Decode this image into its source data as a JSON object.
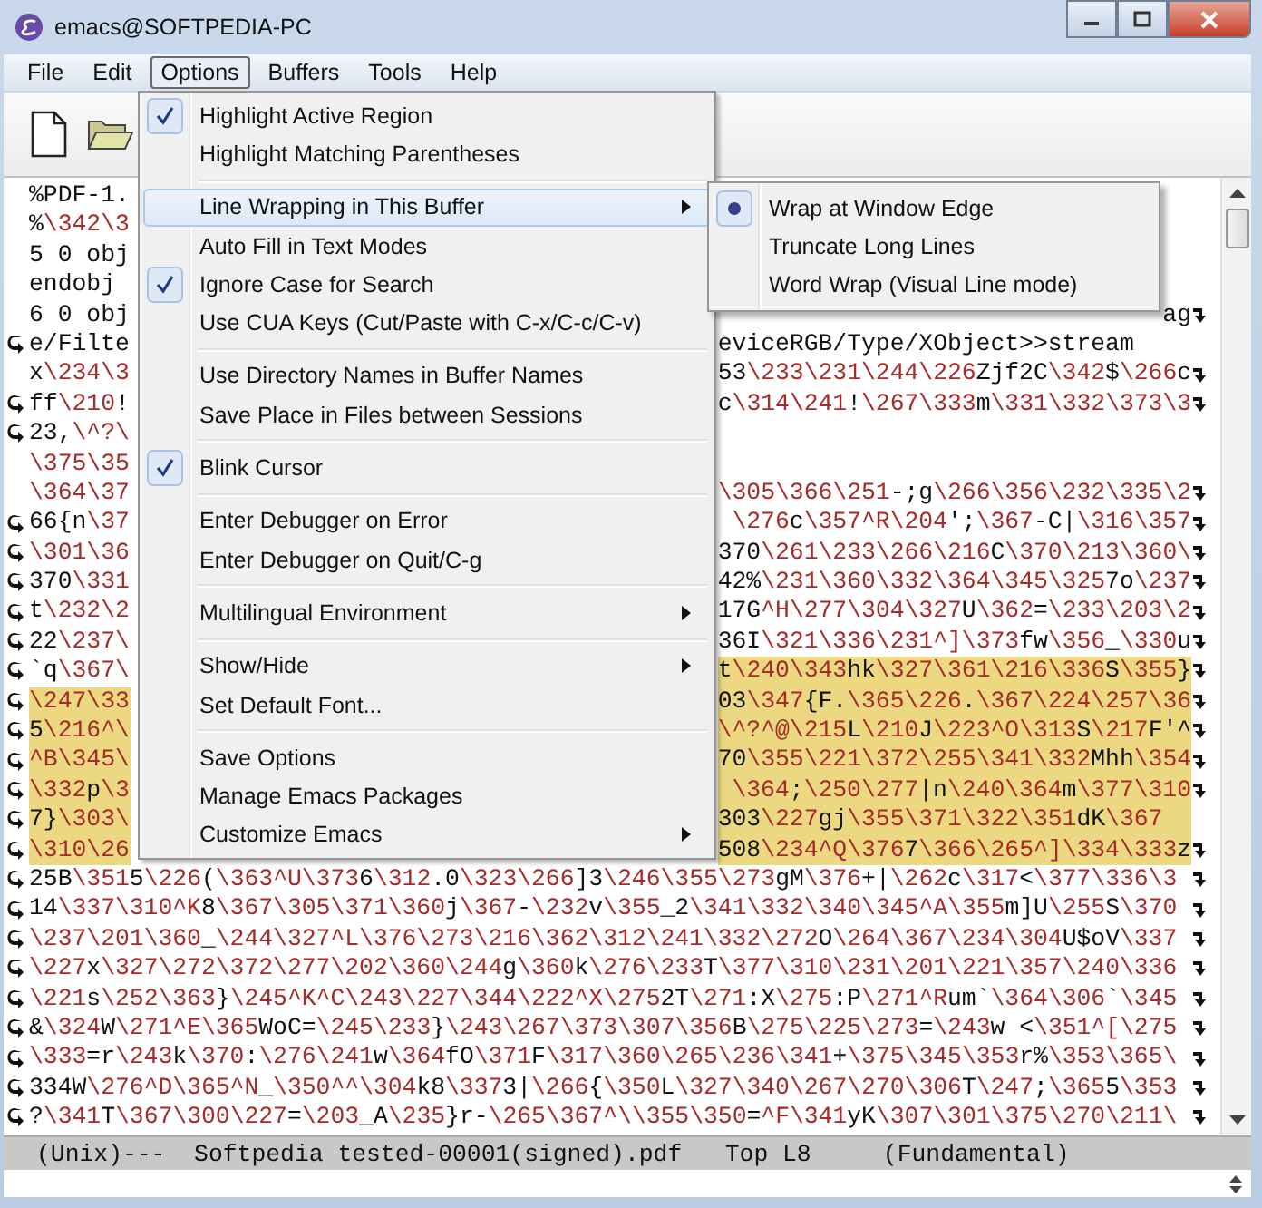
{
  "window": {
    "title": "emacs@SOFTPEDIA-PC"
  },
  "menu_bar": [
    {
      "label": "File",
      "selected": false
    },
    {
      "label": "Edit",
      "selected": false
    },
    {
      "label": "Options",
      "selected": true
    },
    {
      "label": "Buffers",
      "selected": false
    },
    {
      "label": "Tools",
      "selected": false
    },
    {
      "label": "Help",
      "selected": false
    }
  ],
  "options_menu": [
    {
      "kind": "item",
      "label": "Highlight Active Region",
      "checked": true,
      "selected": false,
      "submenu": false
    },
    {
      "kind": "item",
      "label": "Highlight Matching Parentheses",
      "checked": false,
      "selected": false,
      "submenu": false
    },
    {
      "kind": "separator"
    },
    {
      "kind": "item",
      "label": "Line Wrapping in This Buffer",
      "checked": false,
      "selected": true,
      "submenu": true
    },
    {
      "kind": "item",
      "label": "Auto Fill in Text Modes",
      "checked": false,
      "selected": false,
      "submenu": false
    },
    {
      "kind": "item",
      "label": "Ignore Case for Search",
      "checked": true,
      "selected": false,
      "submenu": false
    },
    {
      "kind": "item",
      "label": "Use CUA Keys (Cut/Paste with C-x/C-c/C-v)",
      "checked": false,
      "selected": false,
      "submenu": false
    },
    {
      "kind": "separator"
    },
    {
      "kind": "item",
      "label": "Use Directory Names in Buffer Names",
      "checked": false,
      "selected": false,
      "submenu": false
    },
    {
      "kind": "item",
      "label": "Save Place in Files between Sessions",
      "checked": false,
      "selected": false,
      "submenu": false
    },
    {
      "kind": "separator"
    },
    {
      "kind": "item",
      "label": "Blink Cursor",
      "checked": true,
      "selected": false,
      "submenu": false
    },
    {
      "kind": "separator"
    },
    {
      "kind": "item",
      "label": "Enter Debugger on Error",
      "checked": false,
      "selected": false,
      "submenu": false
    },
    {
      "kind": "item",
      "label": "Enter Debugger on Quit/C-g",
      "checked": false,
      "selected": false,
      "submenu": false
    },
    {
      "kind": "separator"
    },
    {
      "kind": "item",
      "label": "Multilingual Environment",
      "checked": false,
      "selected": false,
      "submenu": true
    },
    {
      "kind": "separator"
    },
    {
      "kind": "item",
      "label": "Show/Hide",
      "checked": false,
      "selected": false,
      "submenu": true
    },
    {
      "kind": "item",
      "label": "Set Default Font...",
      "checked": false,
      "selected": false,
      "submenu": false
    },
    {
      "kind": "separator"
    },
    {
      "kind": "item",
      "label": "Save Options",
      "checked": false,
      "selected": false,
      "submenu": false
    },
    {
      "kind": "item",
      "label": "Manage Emacs Packages",
      "checked": false,
      "selected": false,
      "submenu": false
    },
    {
      "kind": "item",
      "label": "Customize Emacs",
      "checked": false,
      "selected": false,
      "submenu": true
    }
  ],
  "line_wrapping_submenu": [
    {
      "label": "Wrap at Window Edge",
      "selected": true
    },
    {
      "label": "Truncate Long Lines",
      "selected": false
    },
    {
      "label": "Word Wrap (Visual Line mode)",
      "selected": false
    }
  ],
  "buffer_rows": [
    {
      "kind": "split",
      "left": "%PDF-1.",
      "continued": false,
      "continues": false,
      "left_highlighted": false
    },
    {
      "kind": "split",
      "left": "%\\342\\3",
      "continued": false,
      "continues": false,
      "left_highlighted": false
    },
    {
      "kind": "split",
      "left": "5 0 obj",
      "continued": false,
      "continues": false,
      "left_highlighted": false
    },
    {
      "kind": "split",
      "left": "endobj",
      "continued": false,
      "continues": false,
      "left_highlighted": false
    },
    {
      "kind": "split",
      "left": "6 0 obj",
      "right": "ag",
      "continued": false,
      "continues": true,
      "left_highlighted": false,
      "right_highlighted": false
    },
    {
      "kind": "split",
      "left": "e/Filte",
      "right": "eviceRGB/Type/XObject>>stream",
      "continued": true,
      "continues": false,
      "left_highlighted": false,
      "right_highlighted": false
    },
    {
      "kind": "split",
      "left": "x\\234\\3",
      "right": "53\\233\\231\\244\\226Zjf2C\\342$\\266c",
      "continued": false,
      "continues": true,
      "left_highlighted": false,
      "right_highlighted": false
    },
    {
      "kind": "split",
      "left": "ff\\210!",
      "right": "c\\314\\241!\\267\\333m\\331\\332\\373\\3",
      "continued": true,
      "continues": true,
      "left_highlighted": false,
      "right_highlighted": false
    },
    {
      "kind": "split",
      "left": "23,\\^?\\",
      "continued": true,
      "continues": false,
      "left_highlighted": false
    },
    {
      "kind": "split",
      "left": "\\375\\35",
      "continued": false,
      "continues": false,
      "left_highlighted": false
    },
    {
      "kind": "split",
      "left": "\\364\\37",
      "right": "\\305\\366\\251-;g\\266\\356\\232\\335\\2",
      "continued": false,
      "continues": true,
      "left_highlighted": false,
      "right_highlighted": false
    },
    {
      "kind": "split",
      "left": "66{n\\37",
      "right": "\\276c\\357^R\\204';\\367-C|\\316\\357",
      "continued": true,
      "continues": true,
      "left_highlighted": false,
      "right_highlighted": false
    },
    {
      "kind": "split",
      "left": "\\301\\36",
      "right": "370\\261\\233\\266\\216C\\370\\213\\360\\",
      "continued": true,
      "continues": true,
      "left_highlighted": false,
      "right_highlighted": false
    },
    {
      "kind": "split",
      "left": "370\\331",
      "right": "42%\\231\\360\\332\\364\\345\\3257o\\237",
      "continued": true,
      "continues": true,
      "left_highlighted": false,
      "right_highlighted": false
    },
    {
      "kind": "split",
      "left": "t\\232\\2",
      "right": "17G^H\\277\\304\\327U\\362=\\233\\203\\2",
      "continued": true,
      "continues": true,
      "left_highlighted": false,
      "right_highlighted": false
    },
    {
      "kind": "split",
      "left": "22\\237\\",
      "right": "36I\\321\\336\\231^]\\373fw\\356_\\330u",
      "continued": true,
      "continues": true,
      "left_highlighted": false,
      "right_highlighted": false
    },
    {
      "kind": "split",
      "left": "`q\\367\\",
      "right": "t\\240\\343hk\\327\\361\\216\\336S\\355}",
      "continued": true,
      "continues": true,
      "left_highlighted": false,
      "right_highlighted": true
    },
    {
      "kind": "split",
      "left": "\\247\\33",
      "right": "03\\347{F.\\365\\226.\\367\\224\\257\\36",
      "continued": true,
      "continues": true,
      "left_highlighted": true,
      "right_highlighted": true
    },
    {
      "kind": "split",
      "left": "5\\216^\\",
      "right": "\\^?^@\\215L\\210J\\223^O\\313S\\217F'^",
      "continued": true,
      "continues": true,
      "left_highlighted": true,
      "right_highlighted": true
    },
    {
      "kind": "split",
      "left": "^B\\345\\",
      "right": "70\\355\\221\\372\\255\\341\\332Mhh\\354",
      "continued": true,
      "continues": true,
      "left_highlighted": true,
      "right_highlighted": true
    },
    {
      "kind": "split",
      "left": "\\332p\\3",
      "right": "\\364;\\250\\277|n\\240\\364m\\377\\310",
      "continued": true,
      "continues": true,
      "left_highlighted": true,
      "right_highlighted": true
    },
    {
      "kind": "split",
      "left": "7}\\303\\",
      "right": "303\\227gj\\355\\371\\322\\351dK\\367",
      "continued": true,
      "continues": false,
      "left_highlighted": true,
      "right_highlighted": true
    },
    {
      "kind": "split",
      "left": "\\310\\26",
      "right": "508\\234^Q\\3767\\366\\265^]\\334\\333z",
      "continued": true,
      "continues": true,
      "left_highlighted": true,
      "right_highlighted": true
    },
    {
      "kind": "full",
      "left": "25B\\3515\\226(\\363^U\\3736\\312.0\\323\\266]3\\246\\355\\273gM\\376+|\\262c\\317<\\377\\336\\3",
      "continued": true,
      "continues": true,
      "left_highlighted": false
    },
    {
      "kind": "full",
      "left": "14\\337\\310^K8\\367\\305\\371\\360j\\367-\\232v\\355_2\\341\\332\\340\\345^A\\355m]U\\255S\\370",
      "continued": true,
      "continues": true,
      "left_highlighted": false
    },
    {
      "kind": "full",
      "left": "\\237\\201\\360_\\244\\327^L\\376\\273\\216\\362\\312\\241\\332\\272O\\264\\367\\234\\304U$oV\\337",
      "continued": true,
      "continues": true,
      "left_highlighted": false
    },
    {
      "kind": "full",
      "left": "\\227x\\327\\272\\372\\277\\202\\360\\244g\\360k\\276\\233T\\377\\310\\231\\201\\221\\357\\240\\336",
      "continued": true,
      "continues": true,
      "left_highlighted": false
    },
    {
      "kind": "full",
      "left": "\\221s\\252\\363}\\245^K^C\\243\\227\\344\\222^X\\2752T\\271:X\\275:P\\271^Rum`\\364\\306`\\345",
      "continued": true,
      "continues": true,
      "left_highlighted": false
    },
    {
      "kind": "full",
      "left": "&\\324W\\271^E\\365WoC=\\245\\233}\\243\\267\\373\\307\\356B\\275\\225\\273=\\243w <\\351^[\\275",
      "continued": true,
      "continues": true,
      "left_highlighted": false
    },
    {
      "kind": "full",
      "left": "\\333=r\\243k\\370:\\276\\241w\\364fO\\371F\\317\\360\\265\\236\\341+\\375\\345\\353r%\\353\\365\\",
      "continued": true,
      "continues": true,
      "left_highlighted": false
    },
    {
      "kind": "full",
      "left": "334W\\276^D\\365^N_\\350^^\\304k8\\3373|\\266{\\350L\\327\\340\\267\\270\\306T\\247;\\3655\\353",
      "continued": true,
      "continues": true,
      "left_highlighted": false
    },
    {
      "kind": "full",
      "left": "?\\341T\\367\\300\\227=\\203_A\\235}r-\\265\\367^\\\\355\\350=^F\\341yK\\307\\301\\375\\270\\211\\",
      "continued": true,
      "continues": true,
      "left_highlighted": false
    }
  ],
  "mode_line": "(Unix)---  Softpedia tested-00001(signed).pdf   Top L8     (Fundamental)"
}
